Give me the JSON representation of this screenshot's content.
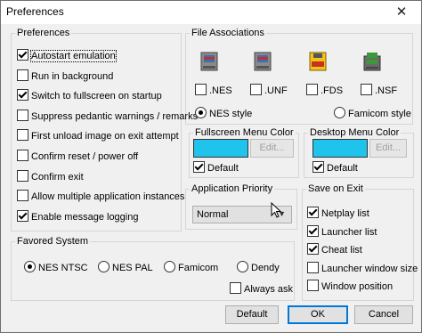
{
  "window": {
    "title": "Preferences"
  },
  "preferences": {
    "legend": "Preferences",
    "items": [
      {
        "label": "Autostart emulation",
        "checked": true,
        "focused": true
      },
      {
        "label": "Run in background",
        "checked": false
      },
      {
        "label": "Switch to fullscreen on startup",
        "checked": true
      },
      {
        "label": "Suppress pedantic warnings / remarks",
        "checked": false
      },
      {
        "label": "First unload image on exit attempt",
        "checked": false
      },
      {
        "label": "Confirm reset / power off",
        "checked": false
      },
      {
        "label": "Confirm exit",
        "checked": false
      },
      {
        "label": "Allow multiple application instances",
        "checked": false
      },
      {
        "label": "Enable message logging",
        "checked": true
      }
    ]
  },
  "file_associations": {
    "legend": "File Associations",
    "items": [
      {
        "label": ".NES",
        "checked": false,
        "icon": "nes-cartridge-icon"
      },
      {
        "label": ".UNF",
        "checked": false,
        "icon": "unf-cartridge-icon"
      },
      {
        "label": ".FDS",
        "checked": false,
        "icon": "fds-disk-icon"
      },
      {
        "label": ".NSF",
        "checked": false,
        "icon": "nsf-cartridge-icon"
      }
    ],
    "styles": [
      {
        "label": "NES style",
        "selected": true
      },
      {
        "label": "Famicom style",
        "selected": false
      }
    ]
  },
  "fullscreen_menu_color": {
    "legend": "Fullscreen Menu Color",
    "edit_label": "Edit...",
    "default_label": "Default",
    "default_checked": true,
    "color": "#1fc3ec"
  },
  "desktop_menu_color": {
    "legend": "Desktop Menu Color",
    "edit_label": "Edit...",
    "default_label": "Default",
    "default_checked": true,
    "color": "#1fc3ec"
  },
  "application_priority": {
    "legend": "Application Priority",
    "value": "Normal"
  },
  "save_on_exit": {
    "legend": "Save on Exit",
    "items": [
      {
        "label": "Netplay list",
        "checked": true
      },
      {
        "label": "Launcher list",
        "checked": true
      },
      {
        "label": "Cheat list",
        "checked": true
      },
      {
        "label": "Launcher window size",
        "checked": false
      },
      {
        "label": "Window position",
        "checked": false
      }
    ]
  },
  "favored_system": {
    "legend": "Favored System",
    "options": [
      {
        "label": "NES NTSC",
        "selected": true
      },
      {
        "label": "NES PAL",
        "selected": false
      },
      {
        "label": "Famicom",
        "selected": false
      },
      {
        "label": "Dendy",
        "selected": false
      }
    ],
    "always_ask_label": "Always ask",
    "always_ask_checked": false
  },
  "buttons": {
    "default": "Default",
    "ok": "OK",
    "cancel": "Cancel"
  },
  "colors": {
    "accent": "#0078d7",
    "swatch": "#1fc3ec"
  }
}
